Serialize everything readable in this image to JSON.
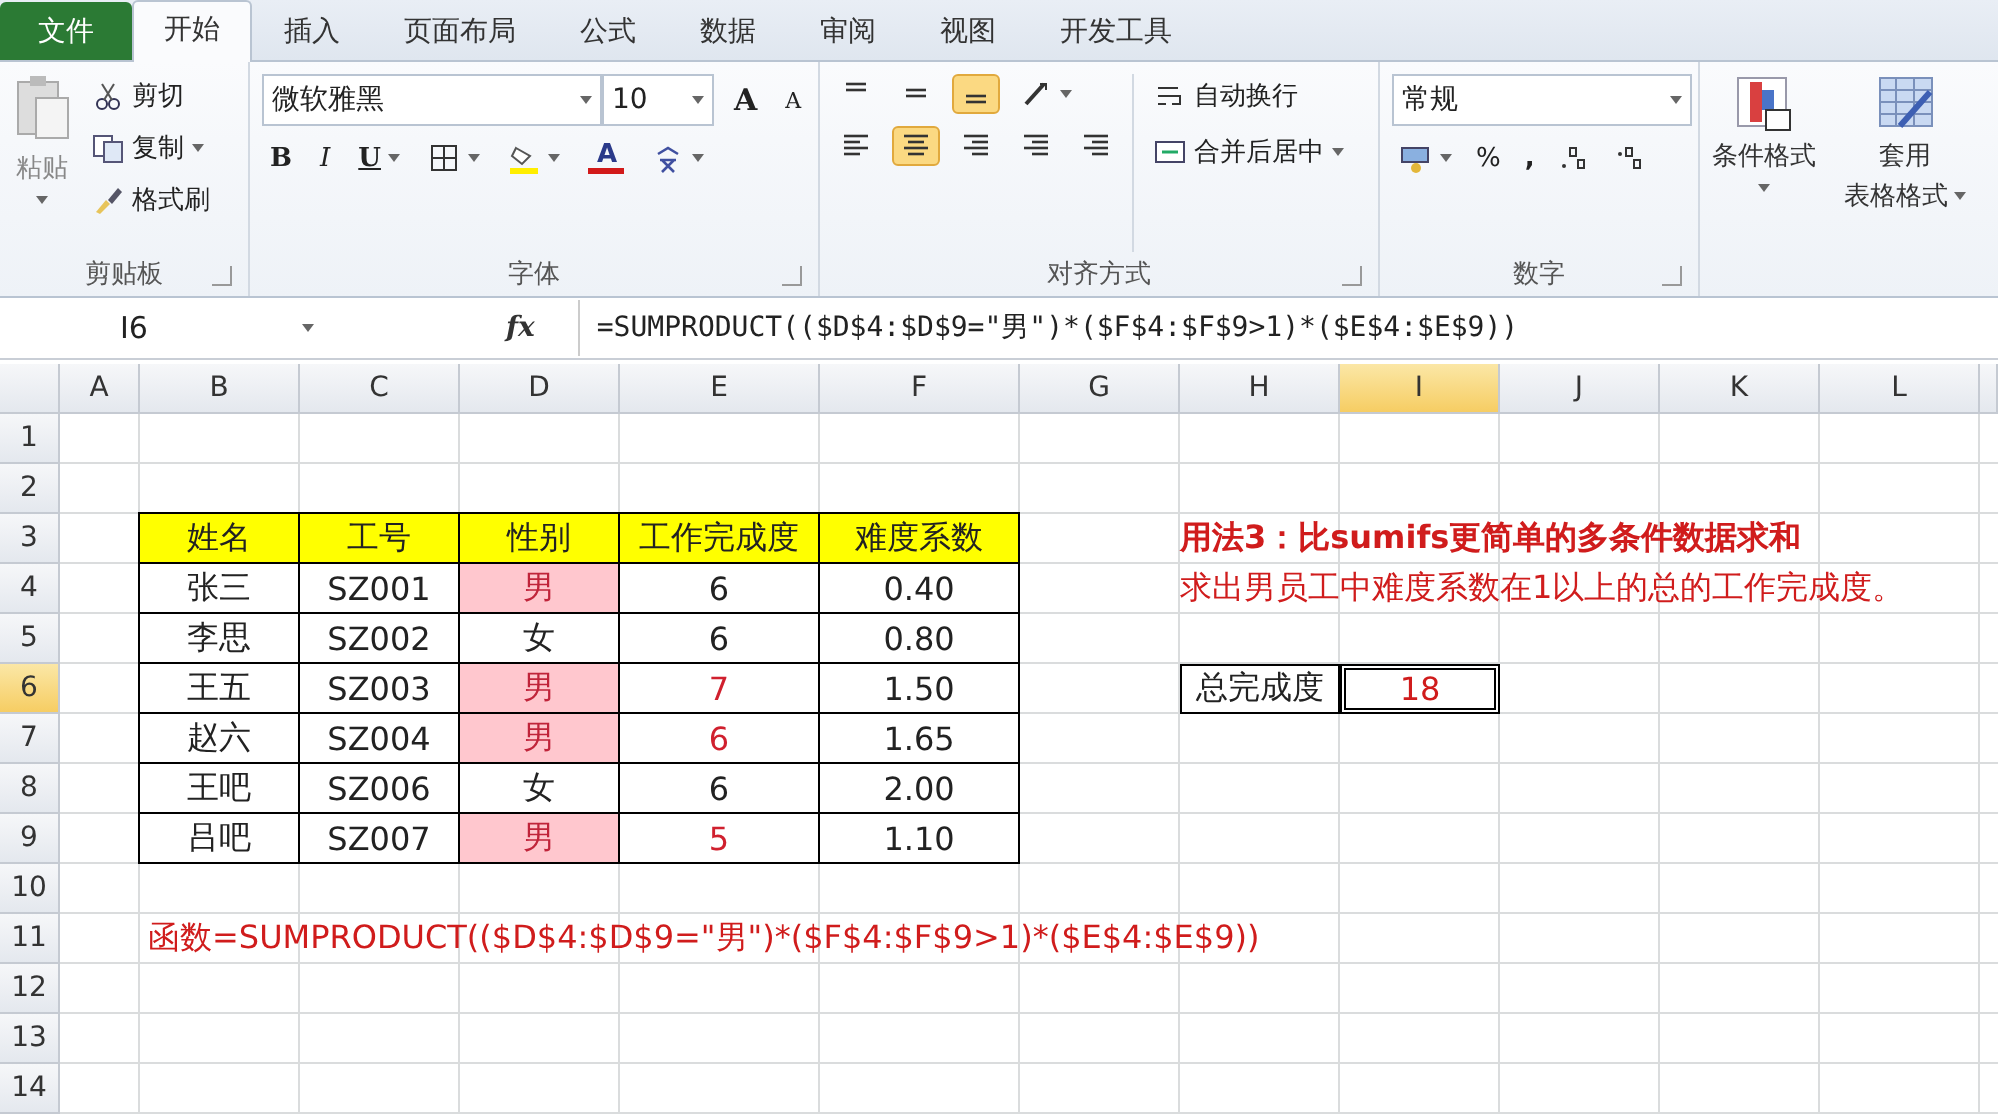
{
  "tabs": [
    {
      "label": "文件",
      "kind": "file",
      "selected": false
    },
    {
      "label": "开始",
      "kind": "tab",
      "selected": true
    },
    {
      "label": "插入",
      "kind": "tab",
      "selected": false
    },
    {
      "label": "页面布局",
      "kind": "tab",
      "selected": false
    },
    {
      "label": "公式",
      "kind": "tab",
      "selected": false
    },
    {
      "label": "数据",
      "kind": "tab",
      "selected": false
    },
    {
      "label": "审阅",
      "kind": "tab",
      "selected": false
    },
    {
      "label": "视图",
      "kind": "tab",
      "selected": false
    },
    {
      "label": "开发工具",
      "kind": "tab",
      "selected": false
    }
  ],
  "ribbon": {
    "clipboard": {
      "paste": "粘贴",
      "cut": "剪切",
      "copy": "复制",
      "format_painter": "格式刷",
      "label": "剪贴板"
    },
    "font": {
      "font_name": "微软雅黑",
      "font_size": "10",
      "grow": "A",
      "shrink": "A",
      "bold": "B",
      "italic": "I",
      "underline": "U",
      "font_color": "A",
      "label": "字体"
    },
    "alignment": {
      "top_selected": false,
      "middle_selected": false,
      "bottom_selected": true,
      "left_selected": false,
      "center_selected": true,
      "right_selected": false,
      "wrap_text": "自动换行",
      "merge_center": "合并后居中",
      "label": "对齐方式"
    },
    "number": {
      "format": "常规",
      "percent": "%",
      "comma": ",",
      "label": "数字"
    },
    "styles": {
      "conditional_format": "条件格式",
      "table_format_line1": "套用",
      "table_format_line2": "表格格式"
    }
  },
  "formula_bar": {
    "name_box": "I6",
    "function_symbol": "fx",
    "formula": "=SUMPRODUCT(($D$4:$D$9=\"男\")*($F$4:$F$9>1)*($E$4:$E$9))"
  },
  "columns": [
    {
      "label": "A",
      "selected": false
    },
    {
      "label": "B",
      "selected": false
    },
    {
      "label": "C",
      "selected": false
    },
    {
      "label": "D",
      "selected": false
    },
    {
      "label": "E",
      "selected": false
    },
    {
      "label": "F",
      "selected": false
    },
    {
      "label": "G",
      "selected": false
    },
    {
      "label": "H",
      "selected": false
    },
    {
      "label": "I",
      "selected": true
    },
    {
      "label": "J",
      "selected": false
    },
    {
      "label": "K",
      "selected": false
    },
    {
      "label": "L",
      "selected": false
    }
  ],
  "rows": [
    {
      "label": "1",
      "selected": false
    },
    {
      "label": "2",
      "selected": false
    },
    {
      "label": "3",
      "selected": false
    },
    {
      "label": "4",
      "selected": false
    },
    {
      "label": "5",
      "selected": false
    },
    {
      "label": "6",
      "selected": true
    },
    {
      "label": "7",
      "selected": false
    },
    {
      "label": "8",
      "selected": false
    },
    {
      "label": "9",
      "selected": false
    },
    {
      "label": "10",
      "selected": false
    },
    {
      "label": "11",
      "selected": false
    },
    {
      "label": "12",
      "selected": false
    },
    {
      "label": "13",
      "selected": false
    },
    {
      "label": "14",
      "selected": false
    }
  ],
  "table": {
    "columns": [
      "姓名",
      "工号",
      "性别",
      "工作完成度",
      "难度系数"
    ],
    "rows": [
      {
        "cells": [
          "张三",
          "SZ001",
          "男",
          "6",
          "0.40"
        ],
        "male": true,
        "counted": false
      },
      {
        "cells": [
          "李思",
          "SZ002",
          "女",
          "6",
          "0.80"
        ],
        "male": false,
        "counted": false
      },
      {
        "cells": [
          "王五",
          "SZ003",
          "男",
          "7",
          "1.50"
        ],
        "male": true,
        "counted": true
      },
      {
        "cells": [
          "赵六",
          "SZ004",
          "男",
          "6",
          "1.65"
        ],
        "male": true,
        "counted": true
      },
      {
        "cells": [
          "王吧",
          "SZ006",
          "女",
          "6",
          "2.00"
        ],
        "male": false,
        "counted": false
      },
      {
        "cells": [
          "吕吧",
          "SZ007",
          "男",
          "5",
          "1.10"
        ],
        "male": true,
        "counted": true
      }
    ]
  },
  "note": {
    "title": "用法3：比sumifs更简单的多条件数据求和",
    "text": "求出男员工中难度系数在1以上的总的工作完成度。"
  },
  "result": {
    "label": "总完成度",
    "value": "18",
    "selected": true
  },
  "function_note": "函数=SUMPRODUCT(($D$4:$D$9=\"男\")*($F$4:$F$9>1)*($E$4:$E$9))"
}
